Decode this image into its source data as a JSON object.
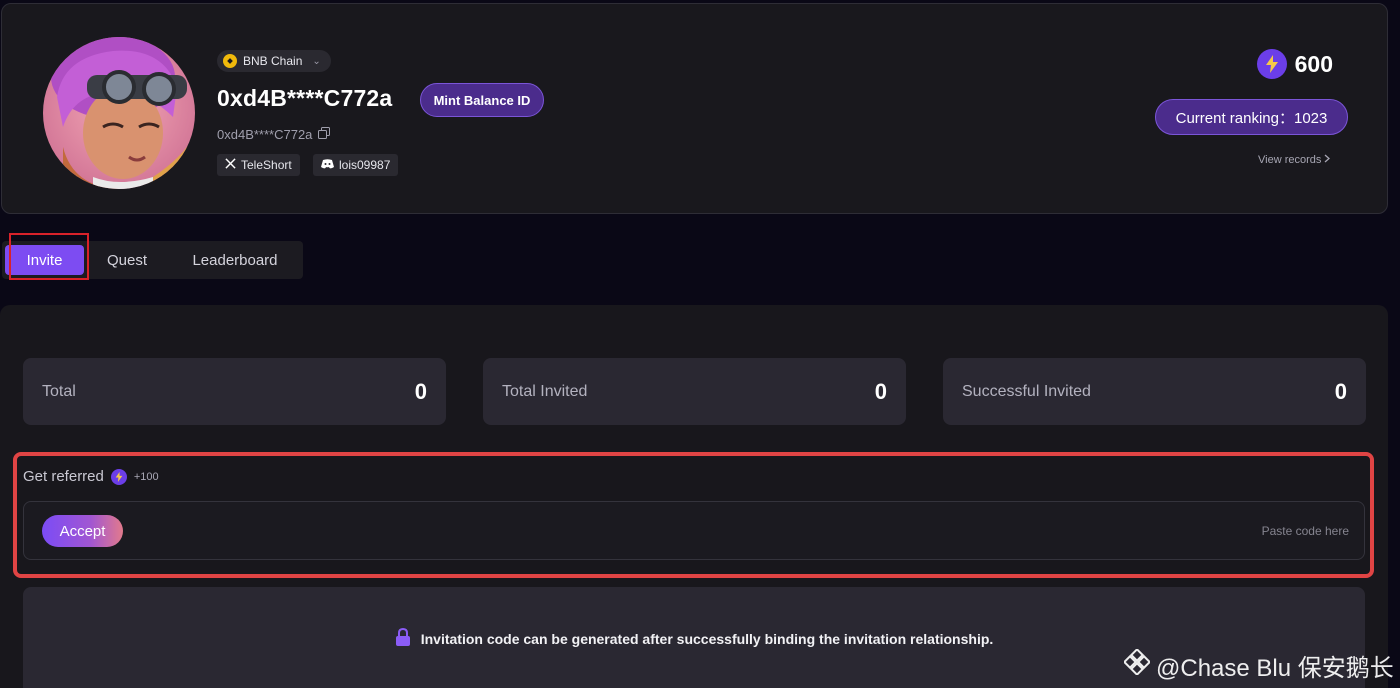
{
  "profile": {
    "chain_label": "BNB Chain",
    "wallet_title": "0xd4B****C772a",
    "wallet_sub": "0xd4B****C772a",
    "mint_button": "Mint Balance ID",
    "socials": {
      "x_handle": "TeleShort",
      "discord_handle": "lois09987"
    },
    "points": "600",
    "ranking": "Current ranking：1023",
    "view_records": "View records"
  },
  "tabs": [
    {
      "label": "Invite",
      "active": true
    },
    {
      "label": "Quest",
      "active": false
    },
    {
      "label": "Leaderboard",
      "active": false
    }
  ],
  "stats": [
    {
      "label": "Total",
      "value": "0"
    },
    {
      "label": "Total Invited",
      "value": "0"
    },
    {
      "label": "Successful Invited",
      "value": "0"
    }
  ],
  "referral": {
    "title": "Get referred",
    "points": "+100",
    "accept_button": "Accept",
    "input_placeholder": "Paste code here"
  },
  "invitation_info": "Invitation code can be generated after successfully binding the invitation relationship.",
  "watermark": "@Chase Blu 保安鹅长",
  "colors": {
    "accent_purple": "#7d4cf2",
    "highlight_red": "#e04444",
    "background": "#0a0816"
  },
  "icons": [
    "bnb-icon",
    "chevron-down-icon",
    "copy-icon",
    "x-logo-icon",
    "discord-icon",
    "bolt-icon",
    "chevron-right-icon",
    "lock-icon",
    "binance-square-icon"
  ]
}
